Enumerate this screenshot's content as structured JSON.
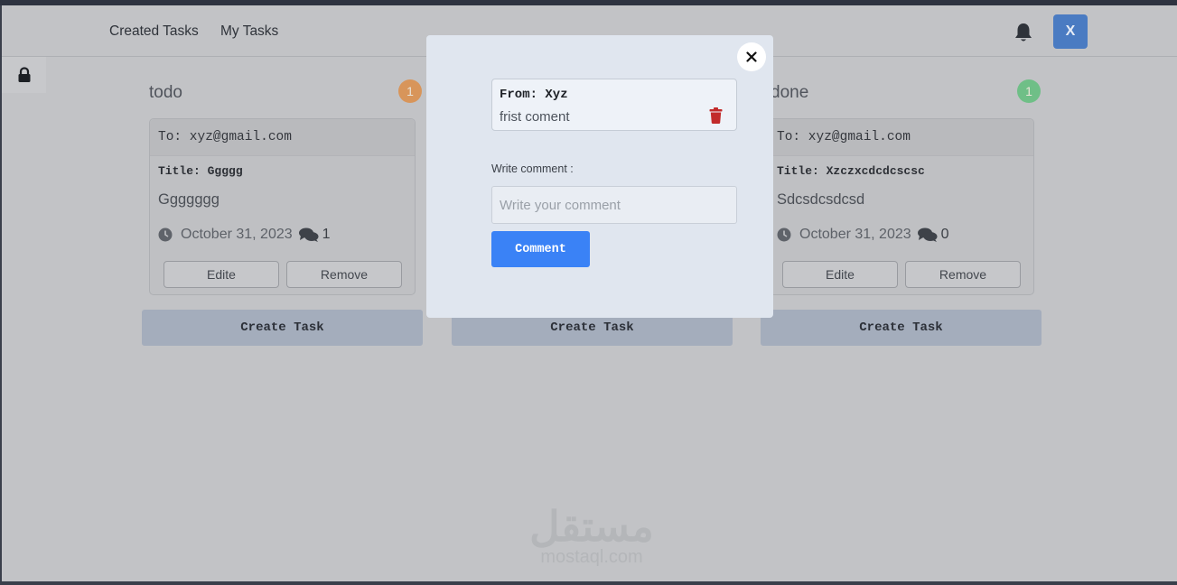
{
  "nav": {
    "links": [
      "Created Tasks",
      "My Tasks"
    ],
    "avatar_initial": "X"
  },
  "columns": [
    {
      "title": "todo",
      "count": "1",
      "badge_color": "#d8955a",
      "card": {
        "to": "To: xyz@gmail.com",
        "title": "Title: Ggggg",
        "body": "Ggggggg",
        "date": "October 31, 2023",
        "comments": "1",
        "edit_label": "Edite",
        "remove_label": "Remove"
      },
      "create_label": "Create Task"
    },
    {
      "create_label": "Create Task"
    },
    {
      "title": "done",
      "count": "1",
      "badge_color": "#6fbf87",
      "card": {
        "to": "To: xyz@gmail.com",
        "title": "Title: Xzczxcdcdcscsc",
        "body": "Sdcsdcsdcsd",
        "date": "October 31, 2023",
        "comments": "0",
        "edit_label": "Edite",
        "remove_label": "Remove"
      },
      "create_label": "Create Task"
    }
  ],
  "modal": {
    "comments": [
      {
        "from": "From: Xyz",
        "text": "frist coment"
      }
    ],
    "write_label": "Write comment :",
    "input_placeholder": "Write your comment",
    "input_value": "",
    "submit_label": "Comment"
  },
  "watermark": {
    "arabic": "مستقل",
    "latin": "mostaql.com"
  },
  "colors": {
    "accent": "#3a82f6",
    "avatar": "#4a7bc2",
    "trash": "#c22b2b"
  }
}
